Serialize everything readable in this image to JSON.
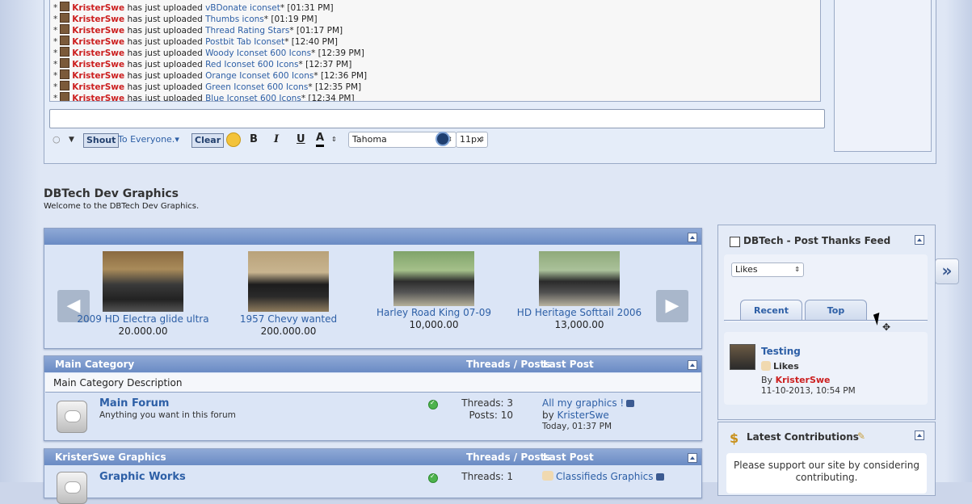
{
  "shoutbox": {
    "messages": [
      {
        "user": "KristerSwe",
        "text": "has just uploaded",
        "link": "vBDonate iconset",
        "time": "* [01:31 PM]"
      },
      {
        "user": "KristerSwe",
        "text": "has just uploaded",
        "link": "Thumbs icons",
        "time": "* [01:19 PM]"
      },
      {
        "user": "KristerSwe",
        "text": "has just uploaded",
        "link": "Thread Rating Stars",
        "time": "* [01:17 PM]"
      },
      {
        "user": "KristerSwe",
        "text": "has just uploaded",
        "link": "Postbit Tab Iconset",
        "time": "* [12:40 PM]"
      },
      {
        "user": "KristerSwe",
        "text": "has just uploaded",
        "link": "Woody Iconset 600 Icons",
        "time": "* [12:39 PM]"
      },
      {
        "user": "KristerSwe",
        "text": "has just uploaded",
        "link": "Red Iconset 600 Icons",
        "time": "* [12:37 PM]"
      },
      {
        "user": "KristerSwe",
        "text": "has just uploaded",
        "link": "Orange Iconset 600 Icons",
        "time": "* [12:36 PM]"
      },
      {
        "user": "KristerSwe",
        "text": "has just uploaded",
        "link": "Green Iconset 600 Icons",
        "time": "* [12:35 PM]"
      },
      {
        "user": "KristerSwe",
        "text": "has just uploaded",
        "link": "Blue Iconset 600 Icons",
        "time": "* [12:34 PM]"
      }
    ],
    "star": "*",
    "input_value": "",
    "shout_label": "Shout",
    "to_label": "To Everyone.",
    "clear_label": "Clear",
    "bold_label": "B",
    "italic_label": "I",
    "underline_label": "U",
    "color_label": "A",
    "font_value": "Tahoma",
    "size_value": "11px"
  },
  "site": {
    "title": "DBTech Dev Graphics",
    "subtitle": "Welcome to the DBTech Dev Graphics."
  },
  "carousel": {
    "items": [
      {
        "caption": "2009 HD Electra glide ultra",
        "price": "20.000.00"
      },
      {
        "caption": "1957 Chevy wanted",
        "price": "200.000.00"
      },
      {
        "caption": "Harley Road King 07-09",
        "price": "10,000.00"
      },
      {
        "caption": "HD Heritage Softtail 2006",
        "price": "13,000.00"
      }
    ]
  },
  "categories": [
    {
      "name": "Main Category",
      "threads_posts_header": "Threads / Posts",
      "last_post_header": "Last Post",
      "description": "Main Category Description",
      "forum": {
        "title": "Main Forum",
        "desc": "Anything you want in this forum",
        "threads": "Threads: 3",
        "posts": "Posts: 10",
        "lp_title": "All my graphics !",
        "lp_by": "by",
        "lp_user": "KristerSwe",
        "lp_date": "Today, 01:37 PM"
      }
    },
    {
      "name": "KristerSwe Graphics",
      "threads_posts_header": "Threads / Posts",
      "last_post_header": "Last Post",
      "forum": {
        "title": "Graphic Works",
        "threads": "Threads: 1",
        "lp_title": "Classifieds Graphics"
      }
    }
  ],
  "sidebar": {
    "thanks_title": "DBTech - Post Thanks Feed",
    "select_value": "Likes",
    "tabs": [
      "Recent",
      "Top"
    ],
    "entry": {
      "title": "Testing",
      "type": "Likes",
      "by": "By",
      "user": "KristerSwe",
      "date": "11-10-2013, 10:54 PM"
    },
    "contrib_title": "Latest Contributions",
    "contrib_text": "Please support our site by considering contributing."
  },
  "colors": {
    "username": "#cc1f1f",
    "link": "#2d5fa6",
    "header": "#6a8bc4"
  }
}
